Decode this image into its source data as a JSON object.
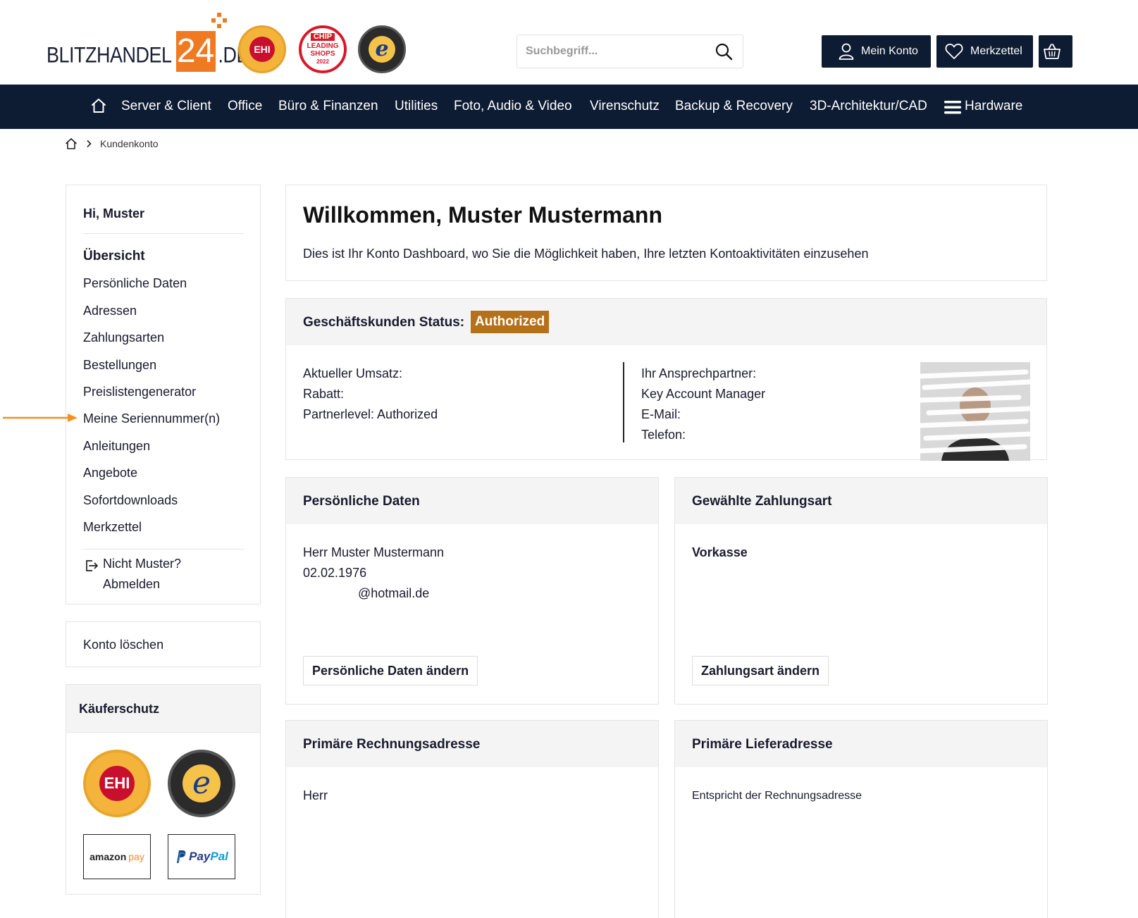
{
  "header": {
    "logo_word": "BLITZHANDEL",
    "logo_number": "24",
    "logo_tld": ".DE",
    "badge_ehi": "EHI",
    "badge_chip_brand": "CHIP",
    "badge_chip_line1": "LEADING",
    "badge_chip_line2": "SHOPS",
    "badge_chip_year": "2022",
    "badge_ts": "e",
    "search_placeholder": "Suchbegriff...",
    "account_label": "Mein Konto",
    "wishlist_label": "Merkzettel"
  },
  "nav": {
    "items": [
      "Server & Client",
      "Office",
      "Büro & Finanzen",
      "Utilities",
      "Foto, Audio & Video",
      "Virenschutz",
      "Backup & Recovery",
      "3D-Architektur/CAD"
    ],
    "hardware": "Hardware"
  },
  "breadcrumb": {
    "current": "Kundenkonto"
  },
  "sidebar": {
    "greeting": "Hi, Muster",
    "items": [
      "Übersicht",
      "Persönliche Daten",
      "Adressen",
      "Zahlungsarten",
      "Bestellungen",
      "Preislistengenerator",
      "Meine Seriennummer(n)",
      "Anleitungen",
      "Angebote",
      "Sofortdownloads",
      "Merkzettel"
    ],
    "logout_line1": "Nicht Muster?",
    "logout_line2": "Abmelden",
    "delete_account": "Konto löschen",
    "protection_title": "Käuferschutz",
    "protect_ehi": "EHI",
    "protect_ts": "e",
    "amazon_word": "amazon",
    "amazon_pay": "pay",
    "paypal_pay": "Pay",
    "paypal_pal": "Pal"
  },
  "welcome": {
    "title": "Willkommen, Muster Mustermann",
    "text": "Dies ist Ihr Konto Dashboard, wo Sie die Möglichkeit haben, Ihre letzten Kontoaktivitäten einzusehen"
  },
  "status": {
    "label": "Geschäftskunden Status:",
    "badge": "Authorized",
    "left": [
      "Aktueller Umsatz:",
      "Rabatt:",
      "Partnerlevel: Authorized"
    ],
    "right": [
      "Ihr Ansprechpartner:",
      "Key Account Manager",
      "E-Mail:",
      "Telefon:"
    ]
  },
  "personal": {
    "title": "Persönliche Daten",
    "name": "Herr Muster Mustermann",
    "birthdate": "02.02.1976",
    "email": "@hotmail.de",
    "button": "Persönliche Daten ändern"
  },
  "payment": {
    "title": "Gewählte Zahlungsart",
    "method": "Vorkasse",
    "button": "Zahlungsart ändern"
  },
  "billing": {
    "title": "Primäre Rechnungsadresse",
    "salutation": "Herr"
  },
  "shipping": {
    "title": "Primäre Lieferadresse",
    "text": "Entspricht der Rechnungsadresse"
  },
  "colors": {
    "navy": "#0d1b33",
    "orange": "#f07a22",
    "authorized": "#b5701a"
  }
}
